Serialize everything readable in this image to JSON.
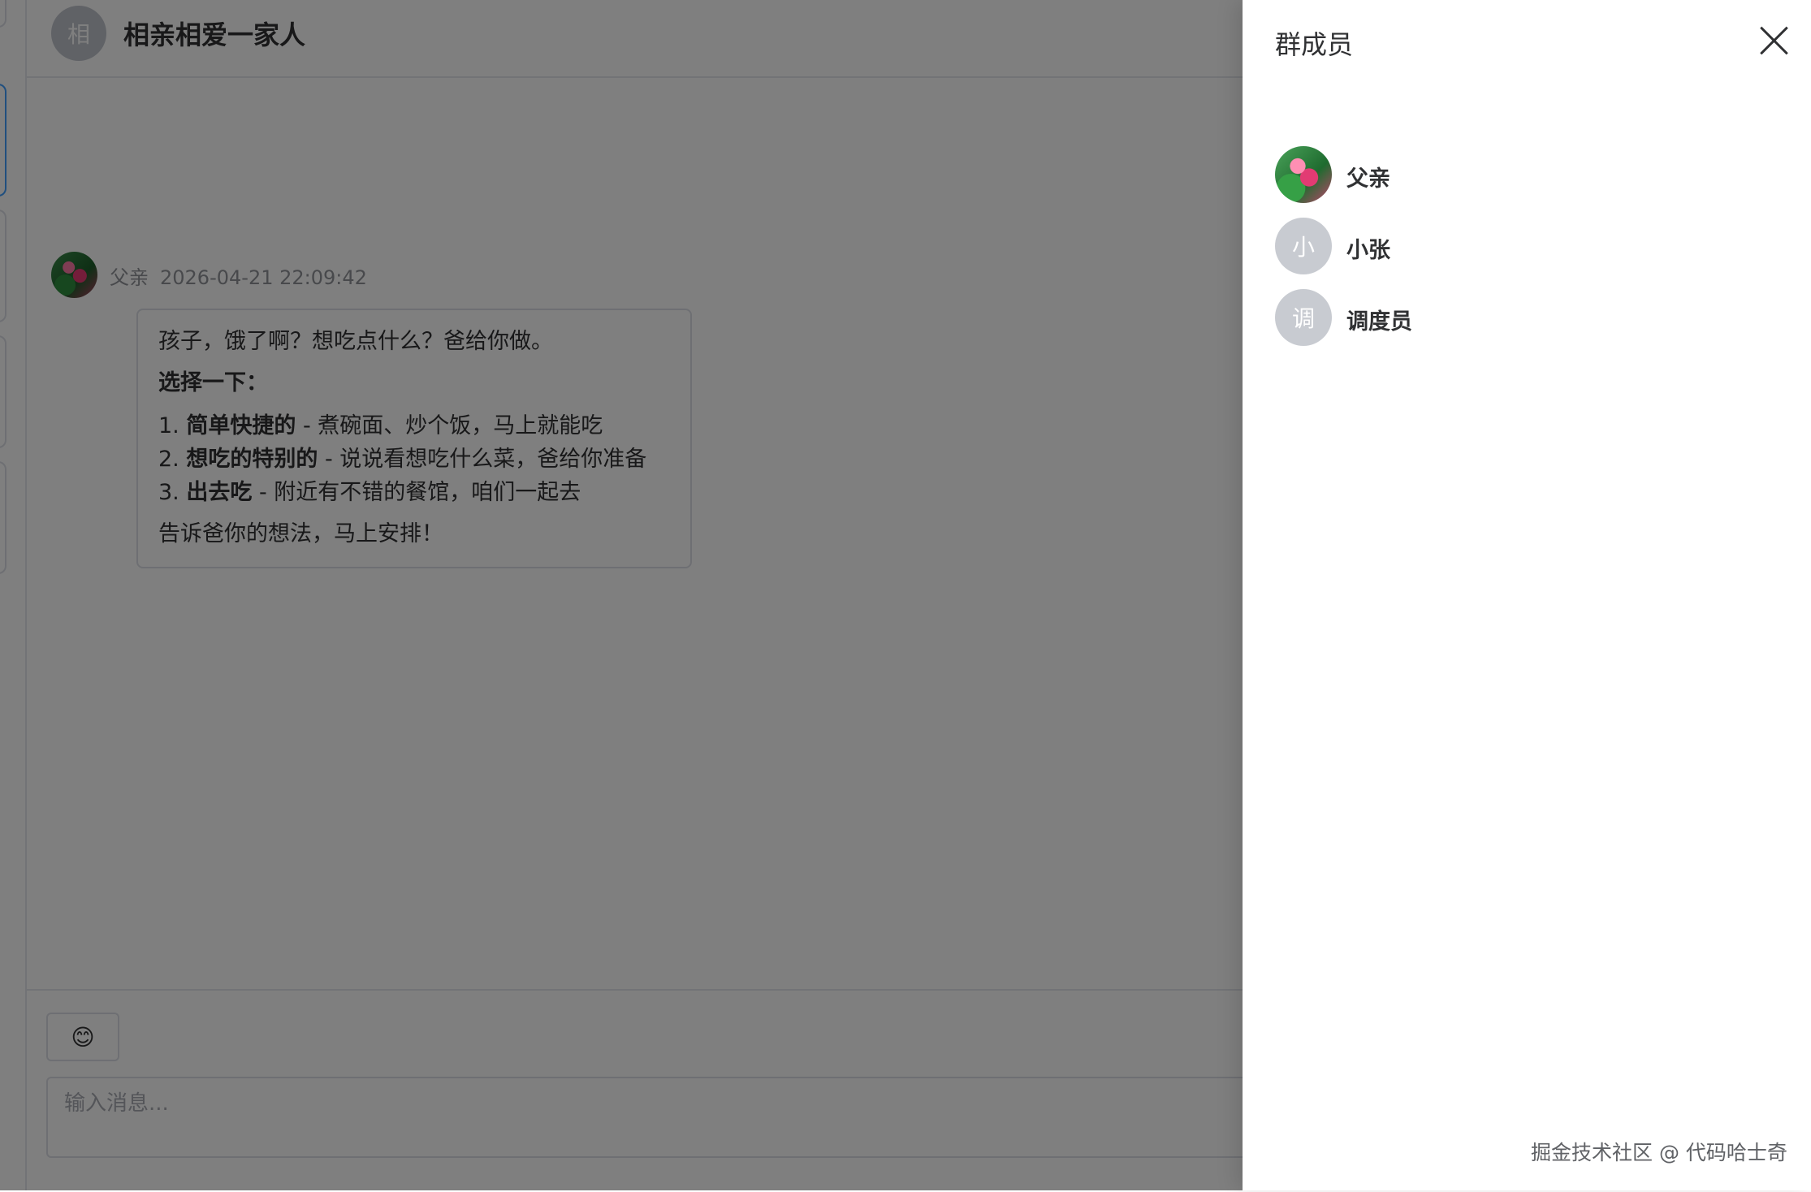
{
  "chat": {
    "group_avatar": "相",
    "group_name": "相亲相爱一家人",
    "message": {
      "sender": "父亲",
      "time": "2026-04-21 22:09:42",
      "intro": "孩子，饿了啊？想吃点什么？爸给你做。",
      "subheading": "选择一下：",
      "options": [
        {
          "num": "1.",
          "bold": "简单快捷的",
          "rest": " - 煮碗面、炒个饭，马上就能吃"
        },
        {
          "num": "2.",
          "bold": "想吃的特别的",
          "rest": " - 说说看想吃什么菜，爸给你准备"
        },
        {
          "num": "3.",
          "bold": "出去吃",
          "rest": " - 附近有不错的餐馆，咱们一起去"
        }
      ],
      "closing": "告诉爸你的想法，马上安排！"
    },
    "emoji_button": "😊",
    "input_placeholder": "输入消息..."
  },
  "drawer": {
    "title": "群成员",
    "members": [
      {
        "name": "父亲",
        "avatar_text": ""
      },
      {
        "name": "小张",
        "avatar_text": "小"
      },
      {
        "name": "调度员",
        "avatar_text": "调"
      }
    ]
  },
  "watermark": "掘金技术社区 @ 代码哈士奇"
}
